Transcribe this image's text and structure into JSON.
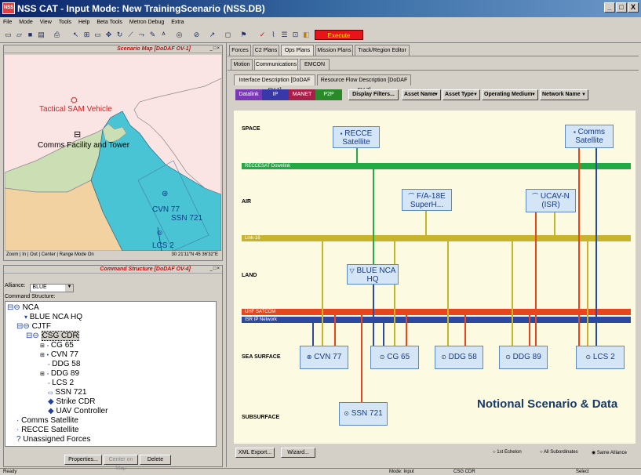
{
  "window": {
    "title": "NSS CAT - Input Mode: New TrainingScenario (NSS.DB)",
    "icon_text": "NSS",
    "controls": [
      "_",
      "□",
      "X"
    ]
  },
  "menu": [
    "File",
    "Mode",
    "View",
    "Tools",
    "Help",
    "Beta Tools",
    "Metron Debug",
    "Extra"
  ],
  "toolbar": {
    "execute_label": "Execute"
  },
  "scenario_map": {
    "title": "Scenario Map [DoDAF OV-1]",
    "labels": {
      "sam": "Tactical SAM Vehicle",
      "comms": "Comms Facility and Tower",
      "cvn": "CVN 77",
      "ssn": "SSN 721",
      "lcs": "LCS 2"
    },
    "controls": [
      "Zoom",
      "In",
      "Out",
      "Center",
      "Range Mode On"
    ],
    "coordinates": "30 21'11\"N   45 36'32\"E"
  },
  "command_structure": {
    "title": "Command Structure [DoDAF OV-4]",
    "alliance_label": "Alliance:",
    "alliance_value": "BLUE",
    "structure_label": "Command Structure:",
    "tree": [
      "NCA",
      "BLUE NCA HQ",
      "CJTF",
      "CSG CDR",
      "CG 65",
      "CVN 77",
      "DDG 58",
      "DDG 89",
      "LCS 2",
      "SSN 721",
      "Strike CDR",
      "UAV Controller",
      "Comms Satellite",
      "RECCE Satellite",
      "Unassigned Forces"
    ],
    "buttons": {
      "properties": "Properties...",
      "center": "Center on Map",
      "delete": "Delete"
    }
  },
  "top_tabs": [
    "Forces",
    "C2 Plans",
    "Ops Plans",
    "Mission Plans",
    "Track/Region Editor"
  ],
  "sub_tabs": [
    "Motion",
    "Communications",
    "EMCON"
  ],
  "view_tabs": [
    "Interface Description [DoDAF SV-1]",
    "Resource Flow Description [DoDAF SV-2]"
  ],
  "filters": {
    "chips": [
      {
        "label": "Datalink",
        "color": "#7a38b8"
      },
      {
        "label": "IP",
        "color": "#3838a8"
      },
      {
        "label": "MANET",
        "color": "#a8204a"
      },
      {
        "label": "P2P",
        "color": "#2a8a2a"
      }
    ],
    "display_filters": "Display Filters...",
    "dropdowns": [
      "Asset Name",
      "Asset Type",
      "Operating Medium",
      "Network Name"
    ]
  },
  "diagram": {
    "layers": [
      "SPACE",
      "AIR",
      "LAND",
      "SEA SURFACE",
      "SUBSURFACE"
    ],
    "networks": {
      "recce": {
        "label": "RECCESAT Downlink",
        "color": "#22aa44"
      },
      "link16": {
        "label": "Link-16",
        "color": "#c8b42a"
      },
      "uhf": {
        "label": "UHF SATCOM",
        "color": "#e8441e"
      },
      "isr": {
        "label": "ISR IP Network",
        "color": "#2a4aa0"
      }
    },
    "nodes": {
      "recce_sat": "RECCE Satellite",
      "comms_sat": "Comms Satellite",
      "fa18": "F/A-18E SuperH...",
      "ucav": "UCAV-N (ISR)",
      "blue_hq": "BLUE NCA HQ",
      "cvn77": "CVN 77",
      "cg65": "CG 65",
      "ddg58": "DDG 58",
      "ddg89": "DDG 89",
      "lcs2": "LCS 2",
      "ssn721": "SSN 721"
    },
    "notice": "Notional Scenario & Data"
  },
  "bottom": {
    "xml_export": "XML Export...",
    "wizard": "Wizard...",
    "radios": [
      "1st Echelon",
      "All Subordinates",
      "Same Alliance"
    ],
    "selected_radio": "Same Alliance"
  },
  "statusbar": {
    "ready": "Ready",
    "mode": "Mode: Input",
    "selection": "CSG CDR",
    "select": "Select"
  }
}
